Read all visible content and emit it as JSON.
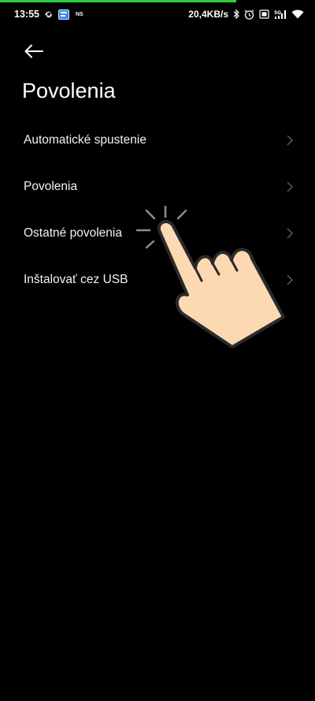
{
  "status_bar": {
    "time": "13:55",
    "notification_label": "NS",
    "network_speed": "20,4KB/s",
    "icons": [
      "gear-icon",
      "app-notification-icon",
      "bluetooth-icon",
      "alarm-icon",
      "vibrate-icon",
      "signal-5g-icon",
      "wifi-icon"
    ]
  },
  "header": {
    "back_icon": "arrow-left-icon",
    "title": "Povolenia"
  },
  "menu": {
    "items": [
      {
        "label": "Automatické spustenie"
      },
      {
        "label": "Povolenia"
      },
      {
        "label": "Ostatné povolenia"
      },
      {
        "label": "Inštalovať cez USB"
      }
    ]
  },
  "colors": {
    "background": "#000000",
    "text": "#ffffff",
    "progress": "#2ecc40",
    "chevron": "#5a5a5a",
    "hand_fill": "#fcd9b3"
  }
}
